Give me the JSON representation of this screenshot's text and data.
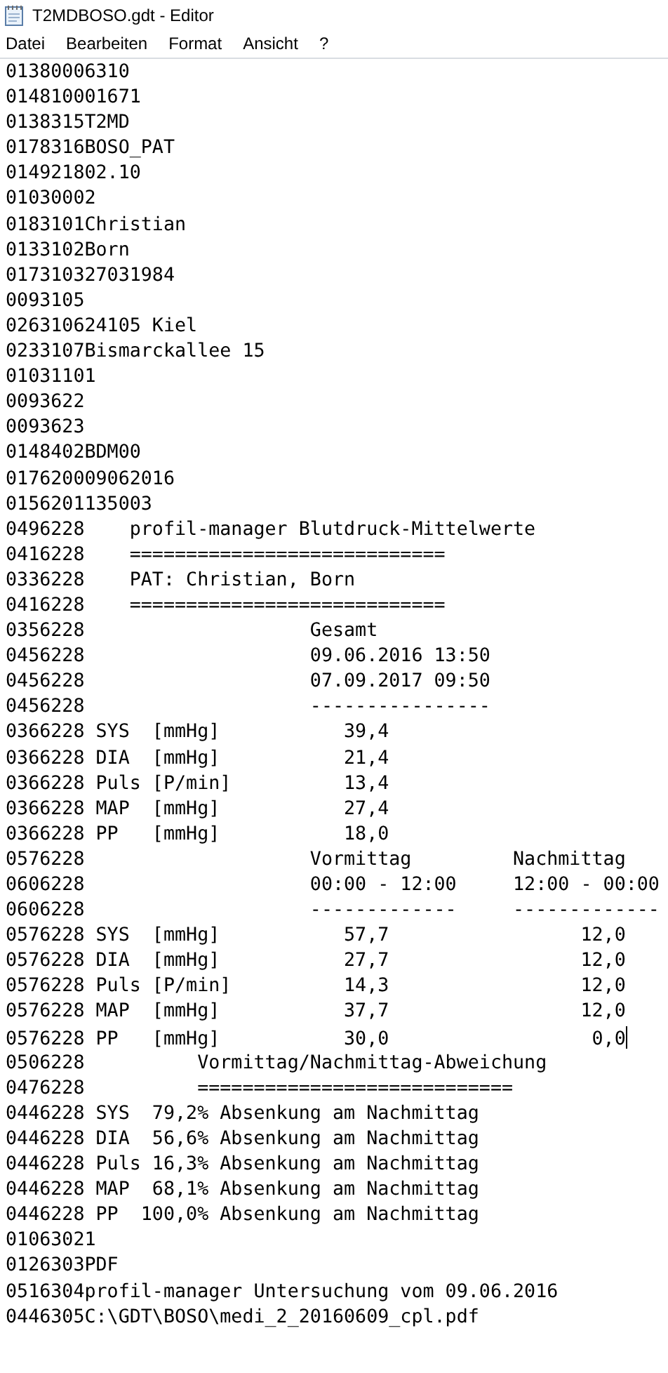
{
  "window": {
    "title": "T2MDBOSO.gdt - Editor"
  },
  "menu": [
    "Datei",
    "Bearbeiten",
    "Format",
    "Ansicht",
    "?"
  ],
  "lines": [
    {
      "text": "01380006310",
      "caret": false
    },
    {
      "text": "014810001671",
      "caret": false
    },
    {
      "text": "0138315T2MD",
      "caret": false
    },
    {
      "text": "0178316BOSO_PAT",
      "caret": false
    },
    {
      "text": "014921802.10",
      "caret": false
    },
    {
      "text": "01030002",
      "caret": false
    },
    {
      "text": "0183101Christian",
      "caret": false
    },
    {
      "text": "0133102Born",
      "caret": false
    },
    {
      "text": "017310327031984",
      "caret": false
    },
    {
      "text": "0093105",
      "caret": false
    },
    {
      "text": "026310624105 Kiel",
      "caret": false
    },
    {
      "text": "0233107Bismarckallee 15",
      "caret": false
    },
    {
      "text": "01031101",
      "caret": false
    },
    {
      "text": "0093622",
      "caret": false
    },
    {
      "text": "0093623",
      "caret": false
    },
    {
      "text": "0148402BDM00",
      "caret": false
    },
    {
      "text": "017620009062016",
      "caret": false
    },
    {
      "text": "0156201135003",
      "caret": false
    },
    {
      "text": "0496228    profil-manager Blutdruck-Mittelwerte",
      "caret": false
    },
    {
      "text": "0416228    ============================",
      "caret": false
    },
    {
      "text": "0336228    PAT: Christian, Born",
      "caret": false
    },
    {
      "text": "0416228    ============================",
      "caret": false
    },
    {
      "text": "0356228                    Gesamt",
      "caret": false
    },
    {
      "text": "0456228                    09.06.2016 13:50",
      "caret": false
    },
    {
      "text": "0456228                    07.09.2017 09:50",
      "caret": false
    },
    {
      "text": "0456228                    ----------------",
      "caret": false
    },
    {
      "text": "0366228 SYS  [mmHg]           39,4",
      "caret": false
    },
    {
      "text": "0366228 DIA  [mmHg]           21,4",
      "caret": false
    },
    {
      "text": "0366228 Puls [P/min]          13,4",
      "caret": false
    },
    {
      "text": "0366228 MAP  [mmHg]           27,4",
      "caret": false
    },
    {
      "text": "0366228 PP   [mmHg]           18,0",
      "caret": false
    },
    {
      "text": "0576228                    Vormittag         Nachmittag",
      "caret": false
    },
    {
      "text": "0606228                    00:00 - 12:00     12:00 - 00:00",
      "caret": false
    },
    {
      "text": "0606228                    -------------     -------------",
      "caret": false
    },
    {
      "text": "0576228 SYS  [mmHg]           57,7                 12,0",
      "caret": false
    },
    {
      "text": "0576228 DIA  [mmHg]           27,7                 12,0",
      "caret": false
    },
    {
      "text": "0576228 Puls [P/min]          14,3                 12,0",
      "caret": false
    },
    {
      "text": "0576228 MAP  [mmHg]           37,7                 12,0",
      "caret": false
    },
    {
      "text": "0576228 PP   [mmHg]           30,0                  0,0",
      "caret": true
    },
    {
      "text": "0506228          Vormittag/Nachmittag-Abweichung",
      "caret": false
    },
    {
      "text": "0476228          ============================",
      "caret": false
    },
    {
      "text": "0446228 SYS  79,2% Absenkung am Nachmittag",
      "caret": false
    },
    {
      "text": "0446228 DIA  56,6% Absenkung am Nachmittag",
      "caret": false
    },
    {
      "text": "0446228 Puls 16,3% Absenkung am Nachmittag",
      "caret": false
    },
    {
      "text": "0446228 MAP  68,1% Absenkung am Nachmittag",
      "caret": false
    },
    {
      "text": "0446228 PP  100,0% Absenkung am Nachmittag",
      "caret": false
    },
    {
      "text": "01063021",
      "caret": false
    },
    {
      "text": "0126303PDF",
      "caret": false
    },
    {
      "text": "0516304profil-manager Untersuchung vom 09.06.2016",
      "caret": false
    },
    {
      "text": "0446305C:\\GDT\\BOSO\\medi_2_20160609_cpl.pdf",
      "caret": false
    }
  ]
}
